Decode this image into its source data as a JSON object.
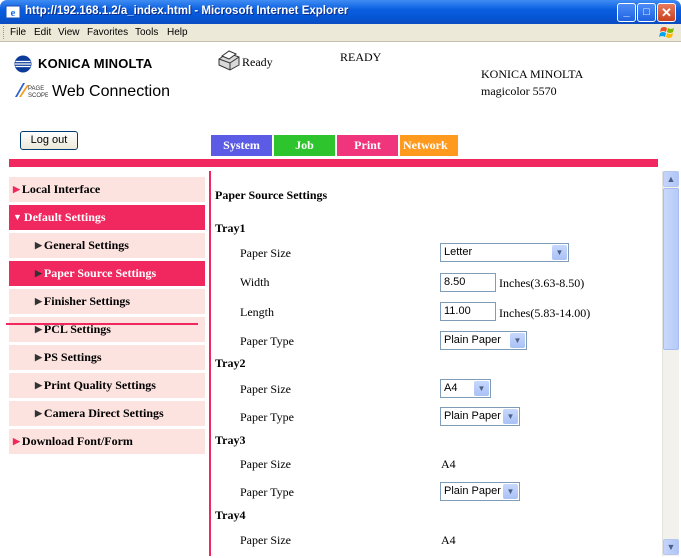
{
  "window": {
    "title": "http://192.168.1.2/a_index.html - Microsoft Internet Explorer",
    "min_glyph": "_",
    "max_glyph": "□",
    "close_glyph": "✕"
  },
  "menu": [
    "File",
    "Edit",
    "View",
    "Favorites",
    "Tools",
    "Help"
  ],
  "header": {
    "brand": "KONICA MINOLTA",
    "product": "Web Connection",
    "status_main": "Ready",
    "status_code": "READY",
    "model_line1": "KONICA MINOLTA",
    "model_line2": "magicolor 5570",
    "logout_label": "Log out"
  },
  "tabs": [
    {
      "label": "System",
      "color": "#5b5be6"
    },
    {
      "label": "Job",
      "color": "#2ec42e"
    },
    {
      "label": "Print",
      "color": "#f0357d"
    },
    {
      "label": "Network",
      "color": "#ff9a1f"
    }
  ],
  "nav": {
    "arrow_right": "▶",
    "arrow_down": "▼",
    "items": [
      {
        "label": "Local Interface"
      },
      {
        "label": "Default Settings"
      },
      {
        "label": "General Settings"
      },
      {
        "label": "Paper Source Settings"
      },
      {
        "label": "Finisher Settings"
      },
      {
        "label": "PCL Settings"
      },
      {
        "label": "PS Settings"
      },
      {
        "label": "Print Quality Settings"
      },
      {
        "label": "Camera Direct Settings"
      },
      {
        "label": "Download Font/Form"
      }
    ]
  },
  "main": {
    "title": "Paper Source Settings",
    "paper_size_label": "Paper Size",
    "paper_type_label": "Paper Type",
    "width_label": "Width",
    "length_label": "Length",
    "tray1": {
      "name": "Tray1",
      "paper_size": "Letter",
      "width": "8.50",
      "width_range": "Inches(3.63-8.50)",
      "length": "11.00",
      "length_range": "Inches(5.83-14.00)",
      "paper_type": "Plain Paper"
    },
    "tray2": {
      "name": "Tray2",
      "paper_size": "A4",
      "paper_type": "Plain Paper"
    },
    "tray3": {
      "name": "Tray3",
      "paper_size": "A4",
      "paper_type": "Plain Paper"
    },
    "tray4": {
      "name": "Tray4",
      "paper_size": "A4"
    }
  }
}
